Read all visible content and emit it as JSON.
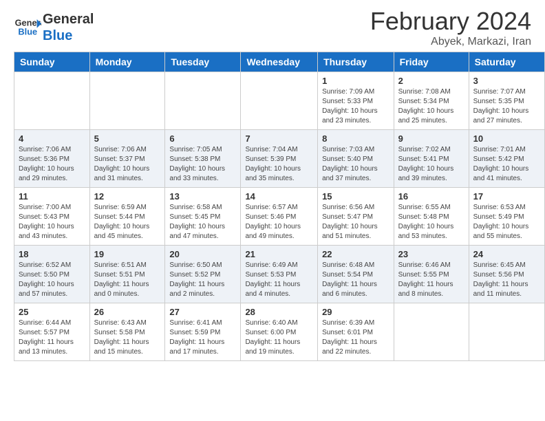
{
  "header": {
    "logo_line1": "General",
    "logo_line2": "Blue",
    "month_year": "February 2024",
    "location": "Abyek, Markazi, Iran"
  },
  "calendar": {
    "days_of_week": [
      "Sunday",
      "Monday",
      "Tuesday",
      "Wednesday",
      "Thursday",
      "Friday",
      "Saturday"
    ],
    "weeks": [
      [
        {
          "day": "",
          "info": ""
        },
        {
          "day": "",
          "info": ""
        },
        {
          "day": "",
          "info": ""
        },
        {
          "day": "",
          "info": ""
        },
        {
          "day": "1",
          "info": "Sunrise: 7:09 AM\nSunset: 5:33 PM\nDaylight: 10 hours\nand 23 minutes."
        },
        {
          "day": "2",
          "info": "Sunrise: 7:08 AM\nSunset: 5:34 PM\nDaylight: 10 hours\nand 25 minutes."
        },
        {
          "day": "3",
          "info": "Sunrise: 7:07 AM\nSunset: 5:35 PM\nDaylight: 10 hours\nand 27 minutes."
        }
      ],
      [
        {
          "day": "4",
          "info": "Sunrise: 7:06 AM\nSunset: 5:36 PM\nDaylight: 10 hours\nand 29 minutes."
        },
        {
          "day": "5",
          "info": "Sunrise: 7:06 AM\nSunset: 5:37 PM\nDaylight: 10 hours\nand 31 minutes."
        },
        {
          "day": "6",
          "info": "Sunrise: 7:05 AM\nSunset: 5:38 PM\nDaylight: 10 hours\nand 33 minutes."
        },
        {
          "day": "7",
          "info": "Sunrise: 7:04 AM\nSunset: 5:39 PM\nDaylight: 10 hours\nand 35 minutes."
        },
        {
          "day": "8",
          "info": "Sunrise: 7:03 AM\nSunset: 5:40 PM\nDaylight: 10 hours\nand 37 minutes."
        },
        {
          "day": "9",
          "info": "Sunrise: 7:02 AM\nSunset: 5:41 PM\nDaylight: 10 hours\nand 39 minutes."
        },
        {
          "day": "10",
          "info": "Sunrise: 7:01 AM\nSunset: 5:42 PM\nDaylight: 10 hours\nand 41 minutes."
        }
      ],
      [
        {
          "day": "11",
          "info": "Sunrise: 7:00 AM\nSunset: 5:43 PM\nDaylight: 10 hours\nand 43 minutes."
        },
        {
          "day": "12",
          "info": "Sunrise: 6:59 AM\nSunset: 5:44 PM\nDaylight: 10 hours\nand 45 minutes."
        },
        {
          "day": "13",
          "info": "Sunrise: 6:58 AM\nSunset: 5:45 PM\nDaylight: 10 hours\nand 47 minutes."
        },
        {
          "day": "14",
          "info": "Sunrise: 6:57 AM\nSunset: 5:46 PM\nDaylight: 10 hours\nand 49 minutes."
        },
        {
          "day": "15",
          "info": "Sunrise: 6:56 AM\nSunset: 5:47 PM\nDaylight: 10 hours\nand 51 minutes."
        },
        {
          "day": "16",
          "info": "Sunrise: 6:55 AM\nSunset: 5:48 PM\nDaylight: 10 hours\nand 53 minutes."
        },
        {
          "day": "17",
          "info": "Sunrise: 6:53 AM\nSunset: 5:49 PM\nDaylight: 10 hours\nand 55 minutes."
        }
      ],
      [
        {
          "day": "18",
          "info": "Sunrise: 6:52 AM\nSunset: 5:50 PM\nDaylight: 10 hours\nand 57 minutes."
        },
        {
          "day": "19",
          "info": "Sunrise: 6:51 AM\nSunset: 5:51 PM\nDaylight: 11 hours\nand 0 minutes."
        },
        {
          "day": "20",
          "info": "Sunrise: 6:50 AM\nSunset: 5:52 PM\nDaylight: 11 hours\nand 2 minutes."
        },
        {
          "day": "21",
          "info": "Sunrise: 6:49 AM\nSunset: 5:53 PM\nDaylight: 11 hours\nand 4 minutes."
        },
        {
          "day": "22",
          "info": "Sunrise: 6:48 AM\nSunset: 5:54 PM\nDaylight: 11 hours\nand 6 minutes."
        },
        {
          "day": "23",
          "info": "Sunrise: 6:46 AM\nSunset: 5:55 PM\nDaylight: 11 hours\nand 8 minutes."
        },
        {
          "day": "24",
          "info": "Sunrise: 6:45 AM\nSunset: 5:56 PM\nDaylight: 11 hours\nand 11 minutes."
        }
      ],
      [
        {
          "day": "25",
          "info": "Sunrise: 6:44 AM\nSunset: 5:57 PM\nDaylight: 11 hours\nand 13 minutes."
        },
        {
          "day": "26",
          "info": "Sunrise: 6:43 AM\nSunset: 5:58 PM\nDaylight: 11 hours\nand 15 minutes."
        },
        {
          "day": "27",
          "info": "Sunrise: 6:41 AM\nSunset: 5:59 PM\nDaylight: 11 hours\nand 17 minutes."
        },
        {
          "day": "28",
          "info": "Sunrise: 6:40 AM\nSunset: 6:00 PM\nDaylight: 11 hours\nand 19 minutes."
        },
        {
          "day": "29",
          "info": "Sunrise: 6:39 AM\nSunset: 6:01 PM\nDaylight: 11 hours\nand 22 minutes."
        },
        {
          "day": "",
          "info": ""
        },
        {
          "day": "",
          "info": ""
        }
      ]
    ]
  }
}
